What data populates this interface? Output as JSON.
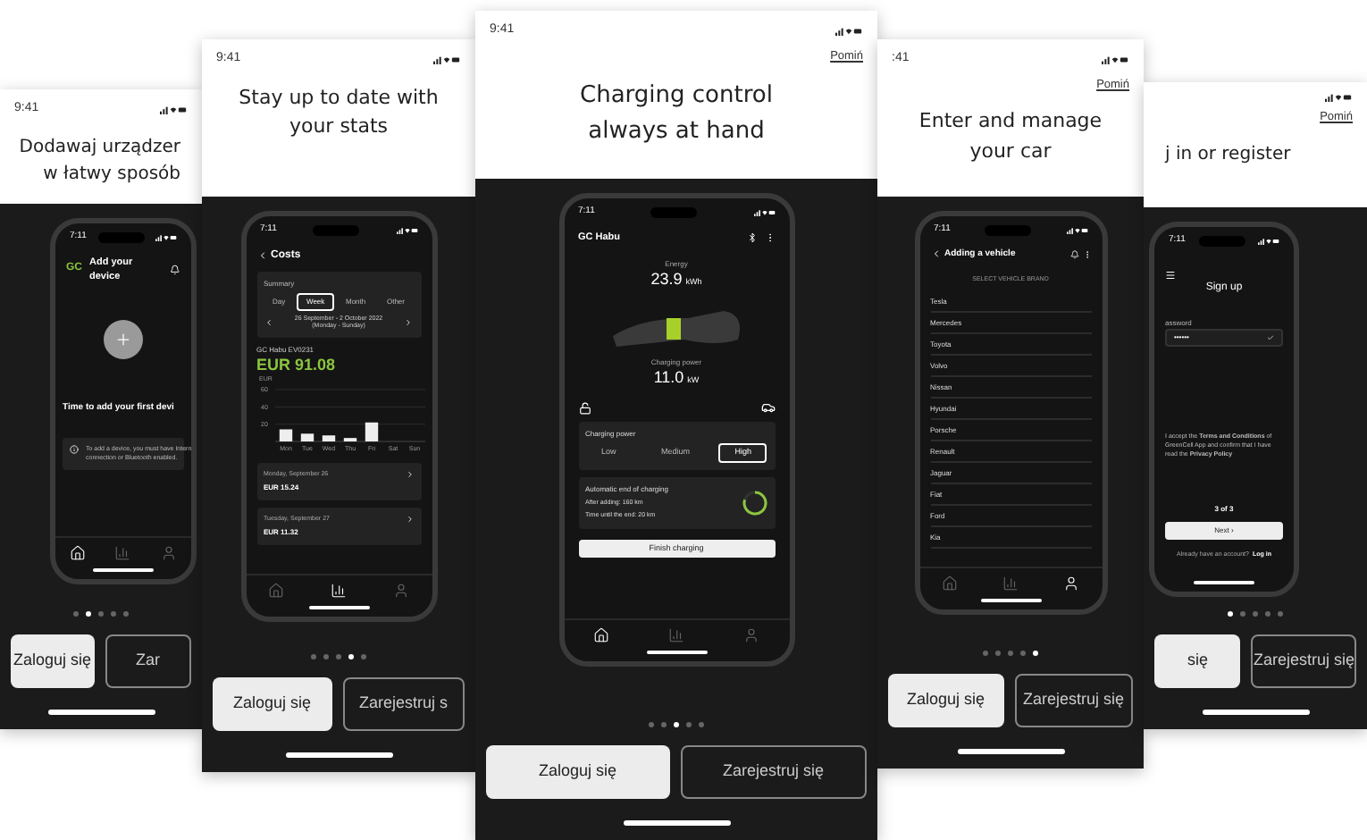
{
  "screens": [
    {
      "kind": "add_device",
      "time": "9:41",
      "title": [
        "Dodawaj urządzer",
        "w łatwy sposób"
      ],
      "phone": {
        "time": "7:11",
        "logo": "GC",
        "header": "Add your device",
        "message": "Time to add your first devi",
        "info": [
          "To add a device, you must have Intern",
          "connection or Bluetooth enabled."
        ],
        "nav": [
          {
            "selected": true
          },
          {
            "selected": false
          },
          {
            "selected": false
          }
        ]
      },
      "dots": [
        {
          "selected": false
        },
        {
          "selected": true
        },
        {
          "selected": false
        },
        {
          "selected": false
        },
        {
          "selected": false
        }
      ],
      "buttons": [
        "Zaloguj się",
        "Zar"
      ]
    },
    {
      "kind": "stats",
      "time": "9:41",
      "title": [
        "Stay up to date with",
        "your stats"
      ],
      "phone": {
        "time": "7:11",
        "header": "Costs",
        "summary": "Summary",
        "periods": [
          {
            "label": "Day",
            "selected": false
          },
          {
            "label": "Week",
            "selected": true
          },
          {
            "label": "Month",
            "selected": false
          },
          {
            "label": "Other",
            "selected": false
          }
        ],
        "range": [
          "26 September - 2 October 2022",
          "(Monday - Sunday)"
        ],
        "device": "GC Habu EV0231",
        "total": "EUR 91.08",
        "chart_data": {
          "type": "bar",
          "ylabel": "EUR",
          "categories": [
            "Mon",
            "Tue",
            "Wed",
            "Thu",
            "Fri",
            "Sat",
            "Sun"
          ],
          "values": [
            14,
            9,
            7,
            4,
            22,
            0,
            0
          ],
          "ylim": [
            0,
            60
          ],
          "yticks": [
            20,
            40,
            60
          ]
        },
        "days": [
          {
            "date": "Monday, September 26",
            "amount": "EUR 15.24"
          },
          {
            "date": "Tuesday, September 27",
            "amount": "EUR 11.32"
          }
        ],
        "nav": [
          {
            "selected": false
          },
          {
            "selected": true
          },
          {
            "selected": false
          }
        ]
      },
      "dots": [
        {
          "selected": false
        },
        {
          "selected": false
        },
        {
          "selected": false
        },
        {
          "selected": true
        },
        {
          "selected": false
        }
      ],
      "buttons": [
        "Zaloguj się",
        "Zarejestruj s"
      ]
    },
    {
      "kind": "charging",
      "time": "9:41",
      "skip": "Pomiń",
      "title": [
        "Charging control",
        "always at hand"
      ],
      "phone": {
        "time": "7:11",
        "header": "GC Habu",
        "energy_label": "Energy",
        "energy": "23.9",
        "energy_unit": "kWh",
        "power_label": "Charging power",
        "power": "11.0",
        "power_unit": "kW",
        "power_card_title": "Charging power",
        "power_options": [
          {
            "label": "Low",
            "selected": false
          },
          {
            "label": "Medium",
            "selected": false
          },
          {
            "label": "High",
            "selected": true
          }
        ],
        "auto_title": "Automatic end of charging",
        "auto_lines": [
          "After adding: 160 km",
          "Time until the end: 20 km"
        ],
        "level": 0.8,
        "finish": "Finish charging",
        "nav": [
          {
            "selected": true
          },
          {
            "selected": false
          },
          {
            "selected": false
          }
        ]
      },
      "dots": [
        {
          "selected": false
        },
        {
          "selected": false
        },
        {
          "selected": true
        },
        {
          "selected": false
        },
        {
          "selected": false
        }
      ],
      "buttons": [
        "Zaloguj się",
        "Zarejestruj się"
      ]
    },
    {
      "kind": "vehicle",
      "time": ":41",
      "skip": "Pomiń",
      "title": [
        "Enter and manage",
        "your car"
      ],
      "phone": {
        "time": "7:11",
        "header": "Adding a vehicle",
        "section": "SELECT VEHICLE BRAND",
        "brands": [
          "Tesla",
          "Mercedes",
          "Toyota",
          "Volvo",
          "Nissan",
          "Hyundai",
          "Porsche",
          "Renault",
          "Jaguar",
          "Fiat",
          "Ford",
          "Kia"
        ],
        "nav": [
          {
            "selected": false
          },
          {
            "selected": false
          },
          {
            "selected": true
          }
        ]
      },
      "dots": [
        {
          "selected": false
        },
        {
          "selected": false
        },
        {
          "selected": false
        },
        {
          "selected": false
        },
        {
          "selected": true
        }
      ],
      "buttons": [
        "Zaloguj się",
        "Zarejestruj się"
      ]
    },
    {
      "kind": "signup",
      "skip": "Pomiń",
      "title": [
        "j in or register"
      ],
      "phone": {
        "time": "7:11",
        "header": "Sign up",
        "field_label": "assword",
        "field_value": "••••••",
        "consent": "I accept the **Terms and Conditions** of GreenCell App and confirm that I have read the **Privacy Policy**",
        "step": "3 of 3",
        "next": "Next ›",
        "account_text": "Already have an account?",
        "login": "Log in"
      },
      "dots": [
        {
          "selected": true
        },
        {
          "selected": false
        },
        {
          "selected": false
        },
        {
          "selected": false
        },
        {
          "selected": false
        }
      ],
      "buttons": [
        "się",
        "Zarejestruj się"
      ]
    }
  ]
}
